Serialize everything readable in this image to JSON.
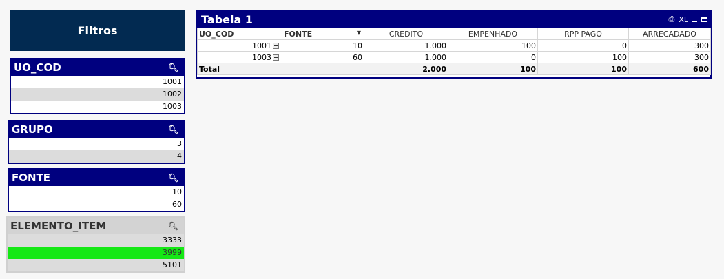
{
  "filtros": {
    "title": "Filtros"
  },
  "listboxes": [
    {
      "title": "UO_COD",
      "items": [
        "1001",
        "1002",
        "1003"
      ]
    },
    {
      "title": "GRUPO",
      "items": [
        "3",
        "4"
      ]
    },
    {
      "title": "FONTE",
      "items": [
        "10",
        "60"
      ]
    },
    {
      "title": "ELEMENTO_ITEM",
      "items": [
        "3333",
        "3999",
        "5101"
      ]
    }
  ],
  "table": {
    "title": "Tabela 1",
    "xl_label": "XL",
    "headers": [
      "UO_COD",
      "FONTE",
      "CREDITO",
      "EMPENHADO",
      "RPP PAGO",
      "ARRECADADO"
    ],
    "rows": [
      {
        "uo": "1001",
        "fonte": "10",
        "credito": "1.000",
        "empenhado": "100",
        "rpp": "0",
        "arrecadado": "300"
      },
      {
        "uo": "1003",
        "fonte": "60",
        "credito": "1.000",
        "empenhado": "0",
        "rpp": "100",
        "arrecadado": "300"
      }
    ],
    "total": {
      "label": "Total",
      "credito": "2.000",
      "empenhado": "100",
      "rpp": "100",
      "arrecadado": "600"
    }
  },
  "colors": {
    "caption": "#00007f",
    "header_block": "#022a51",
    "selected": "#15e815",
    "excluded": "#dcdcdc"
  },
  "icons": [
    "search-icon",
    "print-icon",
    "minimize-icon",
    "maximize-icon",
    "collapse-icon",
    "sort-down-icon"
  ]
}
